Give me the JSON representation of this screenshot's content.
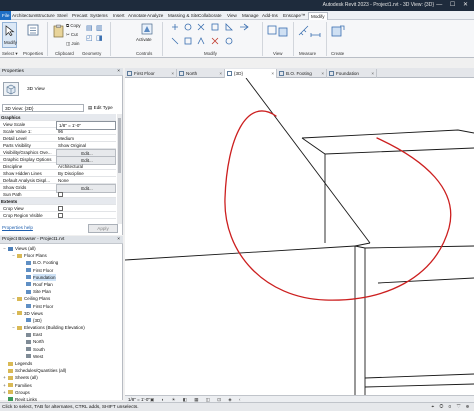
{
  "app": {
    "title": "Autodesk Revit 2023 - Project1.rvt - 3D View: {3D}",
    "window_controls": "— ☐ ✕"
  },
  "ribbon_tabs": [
    "File",
    "Architecture",
    "Structure",
    "Steel",
    "Precast",
    "Systems",
    "Insert",
    "Annotate",
    "Analyze",
    "Massing & Site",
    "Collaborate",
    "View",
    "Manage",
    "Add-Ins",
    "Enscape™",
    "Modify"
  ],
  "ribbon": {
    "modify_label": "Modify",
    "properties_label": "Properties",
    "copy_label": "Copy",
    "cut_label": "Cut",
    "join_label": "Join",
    "activate_label": "Activate",
    "sections": {
      "select": "Select ▾",
      "properties": "Properties",
      "clipboard": "Clipboard",
      "geometry": "Geometry",
      "controls": "Controls",
      "modify": "Modify",
      "view": "View",
      "measure": "Measure",
      "create": "Create"
    }
  },
  "view_tabs": [
    {
      "label": "First Floor",
      "active": false
    },
    {
      "label": "North",
      "active": false
    },
    {
      "label": "{3D}",
      "active": true
    },
    {
      "label": "B.O. Footing",
      "active": false
    },
    {
      "label": "Foundation",
      "active": false
    }
  ],
  "properties": {
    "title": "Properties",
    "close": "×",
    "type_name": "3D View",
    "type_selector": "3D View: {3D}",
    "edit_type": "Edit Type",
    "rows": [
      {
        "section": "Graphics"
      },
      {
        "key": "View Scale",
        "value": "1/8\" = 1'-0\"",
        "box": true
      },
      {
        "key": "Scale Value    1:",
        "value": "96"
      },
      {
        "key": "Detail Level",
        "value": "Medium"
      },
      {
        "key": "Parts Visibility",
        "value": "Show Original"
      },
      {
        "key": "Visibility/Graphics Ove...",
        "value": "Edit...",
        "button": true
      },
      {
        "key": "Graphic Display Options",
        "value": "Edit...",
        "button": true
      },
      {
        "key": "Discipline",
        "value": "Architectural"
      },
      {
        "key": "Show Hidden Lines",
        "value": "By Discipline"
      },
      {
        "key": "Default Analysis Displ...",
        "value": "None"
      },
      {
        "key": "Show Grids",
        "value": "Edit...",
        "button": true
      },
      {
        "key": "Sun Path",
        "check": true
      },
      {
        "section": "Extents"
      },
      {
        "key": "Crop View",
        "check": true
      },
      {
        "key": "Crop Region Visible",
        "check": true
      }
    ],
    "help_link": "Properties help",
    "apply": "Apply"
  },
  "browser": {
    "title": "Project Browser - Project1.rvt",
    "close": "×",
    "nodes": [
      {
        "label": "Views (all)",
        "level": 0,
        "toggle": "−",
        "icon": "views"
      },
      {
        "label": "Floor Plans",
        "level": 1,
        "toggle": "−",
        "icon": "folder"
      },
      {
        "label": "B.O. Footing",
        "level": 2,
        "toggle": "",
        "icon": "plan"
      },
      {
        "label": "First Floor",
        "level": 2,
        "toggle": "",
        "icon": "plan"
      },
      {
        "label": "Foundation",
        "level": 2,
        "toggle": "",
        "icon": "plan",
        "selected": true
      },
      {
        "label": "Roof Plan",
        "level": 2,
        "toggle": "",
        "icon": "plan"
      },
      {
        "label": "Site Plan",
        "level": 2,
        "toggle": "",
        "icon": "plan"
      },
      {
        "label": "Ceiling Plans",
        "level": 1,
        "toggle": "−",
        "icon": "folder"
      },
      {
        "label": "First Floor",
        "level": 2,
        "toggle": "",
        "icon": "plan"
      },
      {
        "label": "3D Views",
        "level": 1,
        "toggle": "−",
        "icon": "folder"
      },
      {
        "label": "{3D}",
        "level": 2,
        "toggle": "",
        "icon": "3d"
      },
      {
        "label": "Elevations (Building Elevation)",
        "level": 1,
        "toggle": "−",
        "icon": "folder"
      },
      {
        "label": "East",
        "level": 2,
        "toggle": "",
        "icon": "elev"
      },
      {
        "label": "North",
        "level": 2,
        "toggle": "",
        "icon": "elev"
      },
      {
        "label": "South",
        "level": 2,
        "toggle": "",
        "icon": "elev"
      },
      {
        "label": "West",
        "level": 2,
        "toggle": "",
        "icon": "elev"
      },
      {
        "label": "Legends",
        "level": 0,
        "toggle": "",
        "icon": "folder"
      },
      {
        "label": "Schedules/Quantities (all)",
        "level": 0,
        "toggle": "",
        "icon": "folder"
      },
      {
        "label": "Sheets (all)",
        "level": 0,
        "toggle": "+",
        "icon": "folder"
      },
      {
        "label": "Families",
        "level": 0,
        "toggle": "+",
        "icon": "folder"
      },
      {
        "label": "Groups",
        "level": 0,
        "toggle": "+",
        "icon": "folder"
      },
      {
        "label": "Revit Links",
        "level": 0,
        "toggle": "",
        "icon": "link"
      }
    ]
  },
  "view_control": {
    "scale": "1/8\" = 1'-0\"",
    "icons": "▣ ◐ ☀ ◧ ▦ ◫ ⊡ ◈ ‹"
  },
  "status": {
    "text": "Click to select, TAB for alternates, CTRL adds, SHIFT unselects.",
    "right_icons": "⌖ ◎ 0 ▽ ⊕"
  },
  "colors": {
    "annotation_circle": "#cc1f1f",
    "file_tab": "#1f6fc5",
    "title_bar": "#1e2b3c"
  }
}
